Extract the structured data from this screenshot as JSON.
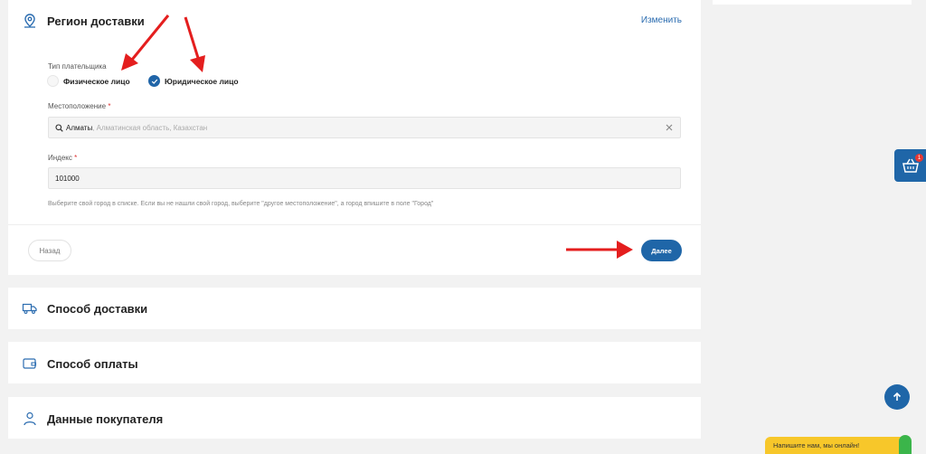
{
  "region": {
    "title": "Регион доставки",
    "change_label": "Изменить",
    "payer_type_label": "Тип плательщика",
    "payer_options": [
      {
        "label": "Физическое лицо",
        "selected": false
      },
      {
        "label": "Юридическое лицо",
        "selected": true
      }
    ],
    "location_label": "Местоположение",
    "location_value": "Алматы",
    "location_detail": ", Алматинская область, Казахстан",
    "index_label": "Индекс",
    "index_value": "101000",
    "required_mark": "*",
    "hint": "Выберите свой город в списке. Если вы не нашли свой город, выберите \"другое местоположение\", а город впишите в поле \"Город\"",
    "back_label": "Назад",
    "next_label": "Далее"
  },
  "sections": {
    "delivery": "Способ доставки",
    "payment": "Способ оплаты",
    "buyer": "Данные покупателя"
  },
  "widgets": {
    "cart_count": "1",
    "chat_label": "Напишите нам, мы онлайн!"
  },
  "colors": {
    "accent": "#1f66a8",
    "annotation": "#e41e1e",
    "chat_bg": "#f7c72a"
  }
}
